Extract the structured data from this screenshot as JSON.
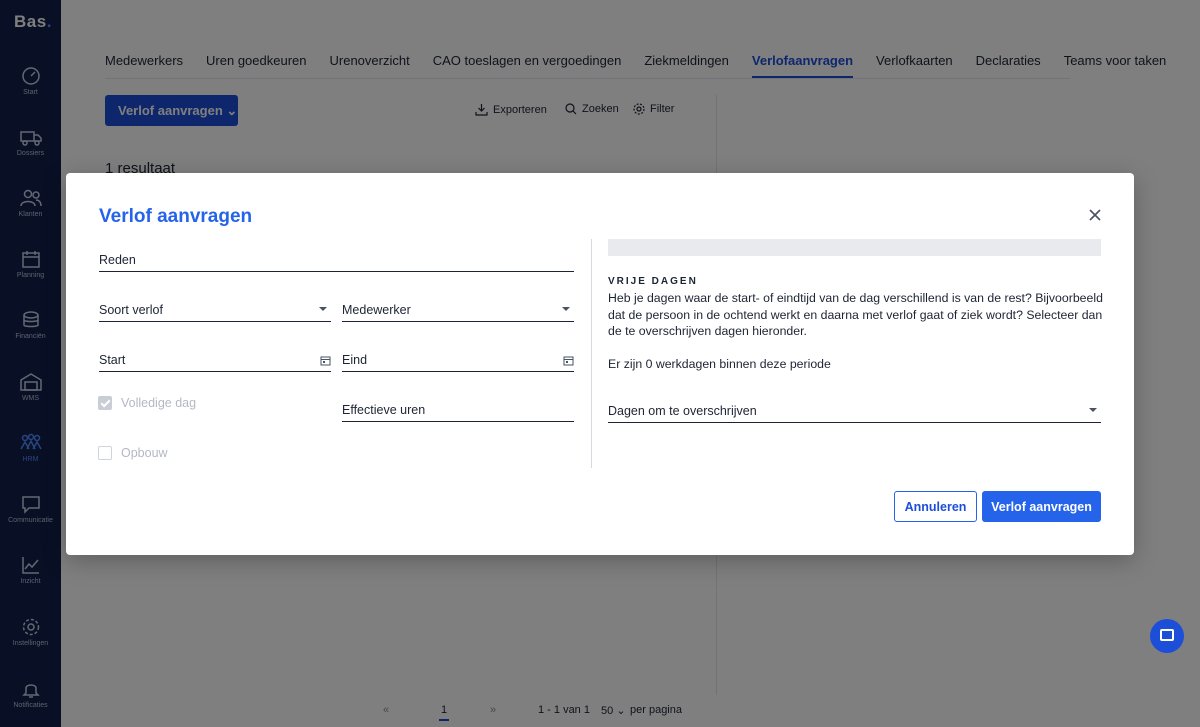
{
  "app": {
    "logo": "Bas",
    "logo_dot": "."
  },
  "sidebar": {
    "items": [
      {
        "label": "Start",
        "icon": "dashboard-icon"
      },
      {
        "label": "Dossiers",
        "icon": "truck-icon"
      },
      {
        "label": "Klanten",
        "icon": "users-icon"
      },
      {
        "label": "Planning",
        "icon": "calendar-icon"
      },
      {
        "label": "Financiën",
        "icon": "coins-icon"
      },
      {
        "label": "WMS",
        "icon": "warehouse-icon"
      },
      {
        "label": "HRM",
        "icon": "team-icon",
        "active": true
      },
      {
        "label": "Communicatie",
        "icon": "chat-icon"
      },
      {
        "label": "Inzicht",
        "icon": "chart-icon"
      },
      {
        "label": "Instellingen",
        "icon": "gear-icon"
      },
      {
        "label": "Notificaties",
        "icon": "bell-icon"
      }
    ]
  },
  "tabs": [
    {
      "label": "Medewerkers"
    },
    {
      "label": "Uren goedkeuren"
    },
    {
      "label": "Urenoverzicht"
    },
    {
      "label": "CAO toeslagen en vergoedingen"
    },
    {
      "label": "Ziekmeldingen"
    },
    {
      "label": "Verlofaanvragen",
      "active": true
    },
    {
      "label": "Verlofkaarten"
    },
    {
      "label": "Declaraties"
    },
    {
      "label": "Teams voor taken"
    }
  ],
  "toolbar": {
    "primary_label": "Verlof aanvragen",
    "export_label": "Exporteren",
    "search_label": "Zoeken",
    "filter_label": "Filter"
  },
  "results_text": "1 resultaat",
  "pagination": {
    "current_page": "1",
    "range_text": "1 - 1 van 1",
    "per_page": "50",
    "per_page_label": "per pagina"
  },
  "modal": {
    "title": "Verlof aanvragen",
    "fields": {
      "reden": "Reden",
      "soort_verlof": "Soort verlof",
      "medewerker": "Medewerker",
      "start": "Start",
      "eind": "Eind",
      "effectieve_uren": "Effectieve uren"
    },
    "checkboxes": {
      "volledige_dag": {
        "label": "Volledige dag",
        "checked": true
      },
      "opbouw": {
        "label": "Opbouw",
        "checked": false
      }
    },
    "vrije_dagen": {
      "heading": "VRIJE DAGEN",
      "text": "Heb je dagen waar de start- of eindtijd van de dag verschillend is van de rest? Bijvoorbeeld dat de persoon in de ochtend werkt en daarna met verlof gaat of ziek wordt? Selecteer dan de te overschrijven dagen hieronder.",
      "workdays_text": "Er zijn 0 werkdagen binnen deze periode",
      "select_label": "Dagen om te overschrijven"
    },
    "buttons": {
      "cancel": "Annuleren",
      "submit": "Verlof aanvragen"
    }
  },
  "colors": {
    "sidebar": "#12204a",
    "accent": "#2563eb",
    "overlay": "rgba(0,0,0,0.5)"
  }
}
